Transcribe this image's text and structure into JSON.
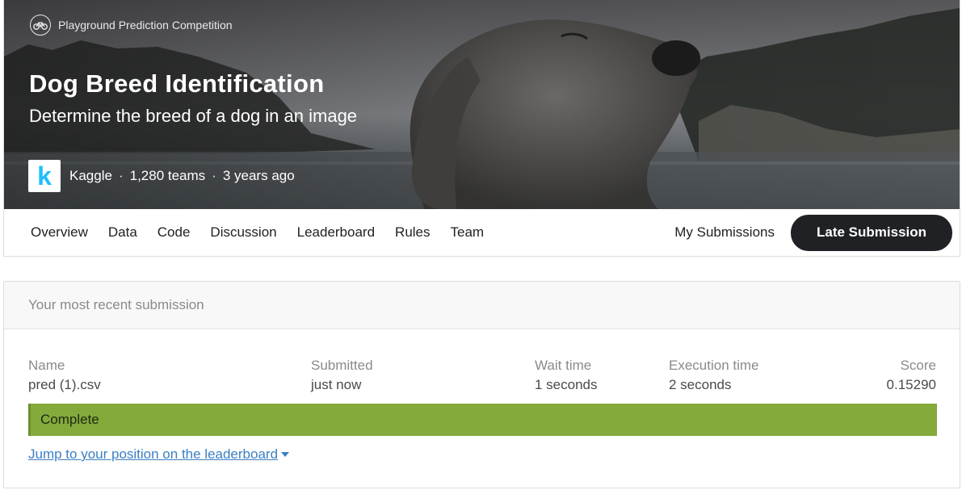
{
  "hero": {
    "competition_type": "Playground Prediction Competition",
    "competition_icon": "bicycle-icon",
    "title": "Dog Breed Identification",
    "subtitle": "Determine the breed of a dog in an image",
    "host_logo_letter": "k",
    "host": "Kaggle",
    "teams": "1,280 teams",
    "age": "3 years ago",
    "separator": "·"
  },
  "tabs": [
    {
      "label": "Overview"
    },
    {
      "label": "Data"
    },
    {
      "label": "Code"
    },
    {
      "label": "Discussion"
    },
    {
      "label": "Leaderboard"
    },
    {
      "label": "Rules"
    },
    {
      "label": "Team"
    }
  ],
  "actions": {
    "my_submissions": "My Submissions",
    "late_submission": "Late Submission"
  },
  "submission": {
    "heading": "Your most recent submission",
    "columns": {
      "name": {
        "label": "Name",
        "value": "pred (1).csv"
      },
      "submitted": {
        "label": "Submitted",
        "value": "just now"
      },
      "wait": {
        "label": "Wait time",
        "value": "1 seconds"
      },
      "execution": {
        "label": "Execution time",
        "value": "2 seconds"
      },
      "score": {
        "label": "Score",
        "value": "0.15290"
      }
    },
    "status": "Complete",
    "jump_link": "Jump to your position on the leaderboard"
  },
  "colors": {
    "accent_dark": "#202124",
    "status_green": "#84aa3c",
    "link_blue": "#3b7fc4",
    "kaggle_blue": "#20beff"
  }
}
